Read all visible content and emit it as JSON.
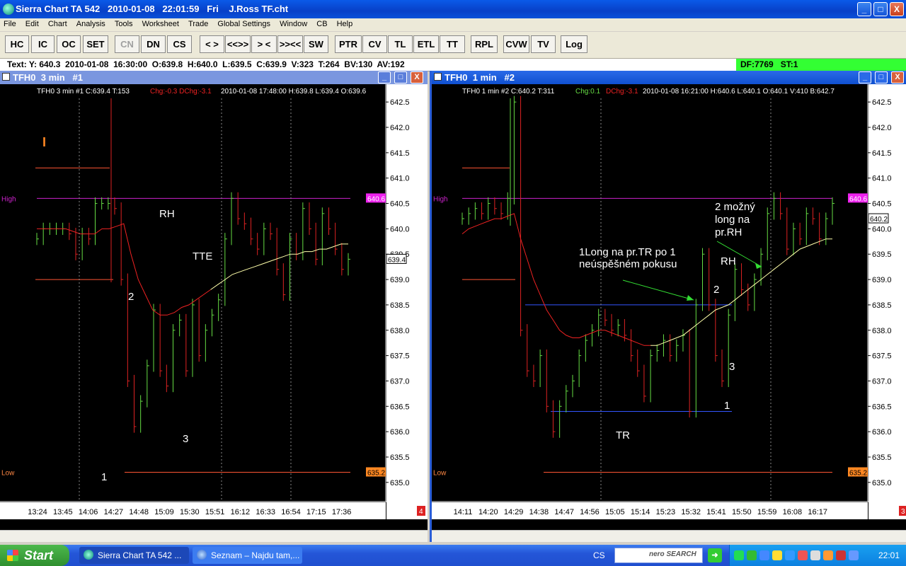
{
  "window": {
    "title": "Sierra Chart TA 542   2010-01-08   22:01:59   Fri    J.Ross TF.cht",
    "controls": {
      "minimize": "_",
      "maximize": "□",
      "close": "X"
    }
  },
  "menu": [
    "File",
    "Edit",
    "Chart",
    "Analysis",
    "Tools",
    "Worksheet",
    "Trade",
    "Global Settings",
    "Window",
    "CB",
    "Help"
  ],
  "toolbar": [
    {
      "label": "HC",
      "enabled": true
    },
    {
      "label": "IC",
      "enabled": true
    },
    {
      "label": "OC",
      "enabled": true
    },
    {
      "label": "SET",
      "enabled": true
    },
    {
      "label": "CN",
      "enabled": false
    },
    {
      "label": "DN",
      "enabled": true
    },
    {
      "label": "CS",
      "enabled": true
    },
    {
      "label": "< >",
      "enabled": true
    },
    {
      "label": "<<>>",
      "enabled": true
    },
    {
      "label": "> <",
      "enabled": true
    },
    {
      "label": ">><<",
      "enabled": true
    },
    {
      "label": "SW",
      "enabled": true
    },
    {
      "label": "PTR",
      "enabled": true
    },
    {
      "label": "CV",
      "enabled": true
    },
    {
      "label": "TL",
      "enabled": true
    },
    {
      "label": "ETL",
      "enabled": true
    },
    {
      "label": "TT",
      "enabled": true
    },
    {
      "label": "RPL",
      "enabled": true
    },
    {
      "label": "CVW",
      "enabled": true
    },
    {
      "label": "TV",
      "enabled": true
    },
    {
      "label": "Log",
      "enabled": true
    }
  ],
  "status": {
    "text": "Text: Y: 640.3  2010-01-08  16:30:00  O:639.8  H:640.0  L:639.5  C:639.9  V:323  T:264  BV:130  AV:192",
    "right": "DF:7769   ST:1"
  },
  "chart1": {
    "window_title": "TFH0  3 min   #1",
    "info": {
      "head": "TFH0  3 min   #1  C:639.4  T:153",
      "chg": "Chg:-0.3  DChg:-3.1",
      "tail": "2010-01-08  17:48:00  H:639.8  L:639.4  O:639.6"
    },
    "high_label": "High",
    "low_label": "Low",
    "high_tag": "640.6",
    "low_tag": "635.2",
    "last_tag": "639.4",
    "page_tag": "4",
    "annotations": [
      "RH",
      "TTE",
      "2",
      "3",
      "1"
    ],
    "marker": "I"
  },
  "chart2": {
    "window_title": "TFH0  1 min   #2",
    "info": {
      "head": "TFH0  1 min   #2  C:640.2  T:311",
      "chg": "Chg:0.1",
      "dchg": "DChg:-3.1",
      "tail": "2010-01-08  16:21:00  H:640.6  L:640.1  O:640.1  V:410  B:642.7"
    },
    "high_label": "High",
    "low_label": "Low",
    "high_tag": "640.6",
    "low_tag": "635.2",
    "last_tag": "640.2",
    "page_tag": "3",
    "annotations": {
      "long1": [
        "1Long na pr.TR po 1",
        "neúspěšném pokusu"
      ],
      "long2": [
        "2 možný",
        "long na",
        "pr.RH"
      ],
      "rh": "RH",
      "tr": "TR",
      "n2": "2",
      "n3": "3",
      "n1": "1"
    }
  },
  "chart_data": [
    {
      "type": "line",
      "title": "TFH0 3 min #1",
      "x_ticks": [
        "13:24",
        "13:45",
        "14:06",
        "14:27",
        "14:48",
        "15:09",
        "15:30",
        "15:51",
        "16:12",
        "16:33",
        "16:54",
        "17:15",
        "17:36"
      ],
      "y_ticks": [
        "642.5",
        "642.0",
        "641.5",
        "641.0",
        "640.5",
        "640.0",
        "639.5",
        "639.0",
        "638.5",
        "638.0",
        "637.5",
        "637.0",
        "636.5",
        "636.0",
        "635.5",
        "635.0"
      ],
      "ylim": [
        634.9,
        642.6
      ],
      "levels": {
        "high": 640.6,
        "low": 635.2
      },
      "series": [
        {
          "name": "Price",
          "color": "#66dd44",
          "values": [
            639.8,
            640.0,
            640.0,
            640.0,
            640.0,
            639.9,
            639.5,
            639.9,
            639.8,
            640.5,
            640.5,
            640.5,
            640.4,
            639.0,
            637.0,
            636.1,
            636.6,
            637.3,
            638.4,
            637.2,
            636.9,
            638.0,
            638.2,
            637.2,
            638.5,
            637.5,
            638.0,
            638.3,
            638.6,
            639.8,
            640.6,
            640.2,
            640.1,
            639.8,
            639.6,
            640.0,
            639.9,
            639.2,
            638.7,
            639.8,
            639.5,
            640.4,
            640.0,
            639.4,
            640.3,
            640.0,
            639.6,
            639.2,
            639.4
          ]
        },
        {
          "name": "Average",
          "color": "#ffffaa",
          "values": [
            640.0,
            640.0,
            640.0,
            640.0,
            640.0,
            639.95,
            639.9,
            639.9,
            639.9,
            640.0,
            640.0,
            640.05,
            640.1,
            639.5,
            639.0,
            638.7,
            638.4,
            638.3,
            638.3,
            638.35,
            638.45,
            638.5,
            638.6,
            638.7,
            638.8,
            638.9,
            639.0,
            639.1,
            639.15,
            639.2,
            639.25,
            639.3,
            639.35,
            639.4,
            639.45,
            639.5,
            639.5,
            639.55,
            639.55,
            639.6,
            639.6,
            639.65,
            639.7,
            639.7
          ]
        }
      ]
    },
    {
      "type": "line",
      "title": "TFH0 1 min #2",
      "x_ticks": [
        "14:11",
        "14:20",
        "14:29",
        "14:38",
        "14:47",
        "14:56",
        "15:05",
        "15:14",
        "15:23",
        "15:32",
        "15:41",
        "15:50",
        "15:59",
        "16:08",
        "16:17"
      ],
      "y_ticks": [
        "642.5",
        "642.0",
        "641.5",
        "641.0",
        "640.5",
        "640.0",
        "639.5",
        "639.0",
        "638.5",
        "638.0",
        "637.5",
        "637.0",
        "636.5",
        "636.0",
        "635.5",
        "635.0"
      ],
      "ylim": [
        634.9,
        642.6
      ],
      "levels": {
        "high": 640.6,
        "low": 635.2,
        "range_top": 638.5,
        "range_bottom": 636.4
      },
      "series": [
        {
          "name": "Price",
          "color": "#66dd44",
          "values": [
            640.2,
            640.3,
            640.4,
            640.3,
            640.5,
            640.4,
            640.3,
            640.6,
            642.5,
            638.0,
            637.2,
            637.0,
            637.5,
            636.5,
            636.0,
            636.5,
            636.8,
            637.0,
            637.5,
            637.8,
            638.0,
            638.3,
            638.2,
            638.0,
            638.1,
            637.9,
            637.5,
            637.2,
            636.7,
            637.5,
            637.6,
            637.8,
            637.5,
            637.7,
            637.9,
            636.4,
            638.5,
            639.5,
            638.5,
            637.5,
            637.0,
            638.3,
            639.2,
            638.8,
            638.5,
            639.0,
            639.5,
            640.3,
            640.6,
            640.3,
            639.6,
            640.0,
            639.8,
            640.3,
            640.2,
            639.8,
            640.2,
            640.5
          ]
        },
        {
          "name": "Average",
          "color": "#ffffaa",
          "values": [
            639.9,
            640.0,
            640.05,
            640.1,
            640.15,
            640.2,
            640.2,
            640.25,
            640.3,
            639.8,
            639.4,
            639.0,
            638.7,
            638.4,
            638.2,
            638.0,
            637.9,
            637.85,
            637.85,
            637.9,
            637.95,
            638.0,
            638.0,
            637.95,
            637.9,
            637.85,
            637.8,
            637.75,
            637.7,
            637.7,
            637.7,
            637.75,
            637.8,
            637.85,
            637.9,
            638.0,
            638.1,
            638.2,
            638.3,
            638.4,
            638.45,
            638.5,
            638.6,
            638.7,
            638.8,
            638.9,
            639.0,
            639.1,
            639.2,
            639.3,
            639.4,
            639.5,
            639.6,
            639.65,
            639.7,
            639.75,
            639.8,
            639.8
          ]
        }
      ]
    }
  ],
  "taskbar": {
    "start": "Start",
    "tasks": [
      "Sierra Chart TA 542 ...",
      "Seznam – Najdu tam,..."
    ],
    "lang": "CS",
    "search_brand": "nero SEARCH",
    "clock": "22:01"
  }
}
